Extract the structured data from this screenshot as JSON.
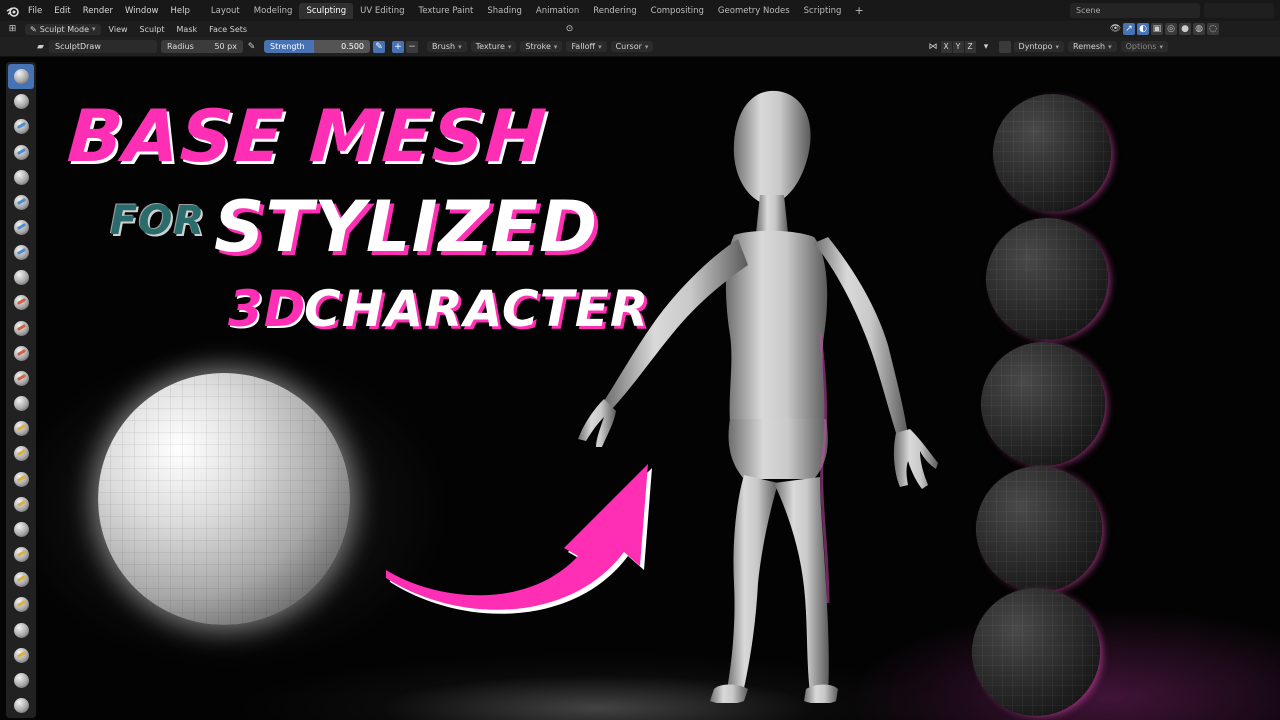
{
  "menubar": {
    "menus": [
      "File",
      "Edit",
      "Render",
      "Window",
      "Help"
    ],
    "workspaces": [
      "Layout",
      "Modeling",
      "Sculpting",
      "UV Editing",
      "Texture Paint",
      "Shading",
      "Animation",
      "Rendering",
      "Compositing",
      "Geometry Nodes",
      "Scripting"
    ],
    "active_workspace": "Sculpting",
    "scene_label": "Scene"
  },
  "header": {
    "mode": "Sculpt Mode",
    "menus": [
      "View",
      "Sculpt",
      "Mask",
      "Face Sets"
    ]
  },
  "tool_settings": {
    "brush_name": "SculptDraw",
    "radius_label": "Radius",
    "radius_value": "50 px",
    "strength_label": "Strength",
    "strength_value": "0.500",
    "dropdowns": [
      "Brush",
      "Texture",
      "Stroke",
      "Falloff",
      "Cursor"
    ],
    "axes": [
      "X",
      "Y",
      "Z"
    ],
    "dyntopo_label": "Dyntopo",
    "remesh_label": "Remesh",
    "options_label": "Options"
  },
  "toolbar": {
    "tools": [
      {
        "name": "draw-brush-icon",
        "accent": ""
      },
      {
        "name": "draw-sharp-brush-icon",
        "accent": ""
      },
      {
        "name": "clay-brush-icon",
        "accent": "#4a8fd0"
      },
      {
        "name": "clay-strips-brush-icon",
        "accent": "#4a8fd0"
      },
      {
        "name": "clay-thumb-brush-icon",
        "accent": ""
      },
      {
        "name": "layer-brush-icon",
        "accent": "#4a8fd0"
      },
      {
        "name": "inflate-brush-icon",
        "accent": "#4a8fd0"
      },
      {
        "name": "blob-brush-icon",
        "accent": "#4a8fd0"
      },
      {
        "name": "crease-brush-icon",
        "accent": ""
      },
      {
        "name": "smooth-brush-icon",
        "accent": "#d06040"
      },
      {
        "name": "flatten-brush-icon",
        "accent": "#d06040"
      },
      {
        "name": "fill-brush-icon",
        "accent": "#d06040"
      },
      {
        "name": "scrape-brush-icon",
        "accent": "#d06040"
      },
      {
        "name": "multiplane-scrape-brush-icon",
        "accent": ""
      },
      {
        "name": "pinch-brush-icon",
        "accent": "#d8b040"
      },
      {
        "name": "grab-brush-icon",
        "accent": "#d8b040"
      },
      {
        "name": "elastic-deform-brush-icon",
        "accent": "#d8b040"
      },
      {
        "name": "snake-hook-brush-icon",
        "accent": "#d8b040"
      },
      {
        "name": "thumb-brush-icon",
        "accent": ""
      },
      {
        "name": "pose-brush-icon",
        "accent": "#d8b040"
      },
      {
        "name": "nudge-brush-icon",
        "accent": "#d8b040"
      },
      {
        "name": "rotate-brush-icon",
        "accent": "#d8b040"
      },
      {
        "name": "slide-relax-brush-icon",
        "accent": ""
      },
      {
        "name": "boundary-brush-icon",
        "accent": "#d8b040"
      },
      {
        "name": "cloth-brush-icon",
        "accent": ""
      },
      {
        "name": "simplify-brush-icon",
        "accent": ""
      }
    ]
  },
  "thumbnail": {
    "line1": "BASE MESH",
    "line2a": "FOR",
    "line2b": "STYLIZED",
    "line3a": "3D",
    "line3b": "CHARACTER",
    "accent_color": "#ff2fb5"
  }
}
